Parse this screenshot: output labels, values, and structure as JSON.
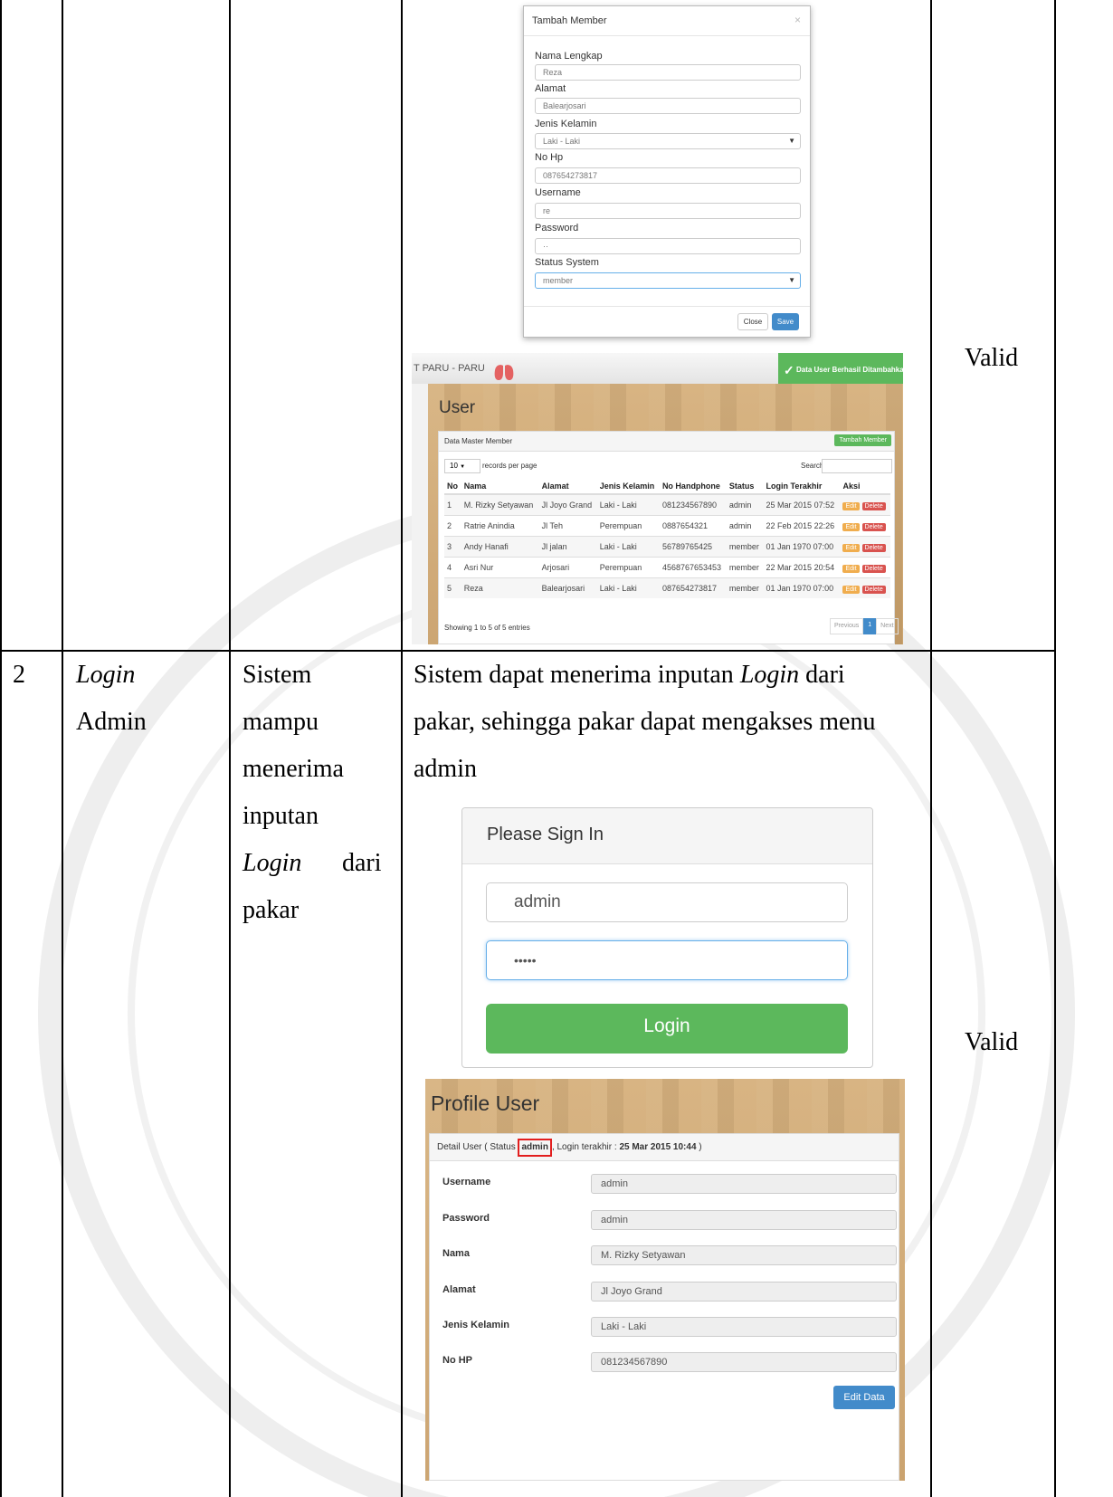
{
  "table": {
    "row1_result": "Valid",
    "row2": {
      "no": "2",
      "name_italic": "Login",
      "name_rest": "Admin",
      "skenario_lines": [
        "Sistem",
        "mampu",
        "menerima",
        "inputan"
      ],
      "skenario_italic": "Login",
      "skenario_dari": "dari",
      "skenario_last": "pakar",
      "hasil_part1": "Sistem dapat menerima inputan",
      "hasil_italic": "Login",
      "hasil_part2": "dari",
      "hasil_line2": "pakar, sehingga pakar dapat mengakses menu",
      "hasil_line3": "admin",
      "result": "Valid"
    }
  },
  "modal": {
    "title": "Tambah Member",
    "close_x": "×",
    "fields": [
      {
        "label": "Nama Lengkap",
        "value": "Reza"
      },
      {
        "label": "Alamat",
        "value": "Balearjosari"
      },
      {
        "label": "Jenis Kelamin",
        "value": "Laki - Laki"
      },
      {
        "label": "No Hp",
        "value": "087654273817"
      },
      {
        "label": "Username",
        "value": "re"
      },
      {
        "label": "Password",
        "value": "··"
      },
      {
        "label": "Status System",
        "value": "member"
      }
    ],
    "close_button": "Close",
    "save_button": "Save"
  },
  "user_page": {
    "brand": "T PARU - PARU",
    "toast": "Data User Berhasil Ditambahkan",
    "heading": "User",
    "panel_title": "Data Master Member",
    "add_button": "Tambah Member",
    "page_size": "10",
    "records_label": "records per page",
    "search_label": "Search:",
    "columns": [
      "No",
      "Nama",
      "Alamat",
      "Jenis Kelamin",
      "No Handphone",
      "Status",
      "Login Terakhir",
      "Aksi"
    ],
    "rows": [
      [
        "1",
        "M. Rizky Setyawan",
        "Jl Joyo Grand",
        "Laki - Laki",
        "081234567890",
        "admin",
        "25 Mar 2015 07:52"
      ],
      [
        "2",
        "Ratrie Anindia",
        "Jl Teh",
        "Perempuan",
        "0887654321",
        "admin",
        "22 Feb 2015 22:26"
      ],
      [
        "3",
        "Andy Hanafi",
        "Jl jalan",
        "Laki - Laki",
        "56789765425",
        "member",
        "01 Jan 1970 07:00"
      ],
      [
        "4",
        "Asri Nur",
        "Arjosari",
        "Perempuan",
        "4568767653453",
        "member",
        "22 Mar 2015 20:54"
      ],
      [
        "5",
        "Reza",
        "Balearjosari",
        "Laki - Laki",
        "087654273817",
        "member",
        "01 Jan 1970 07:00"
      ]
    ],
    "edit_label": "Edit",
    "delete_label": "Delete",
    "showing": "Showing 1 to 5 of 5 entries",
    "prev": "Previous",
    "page": "1",
    "next": "Next"
  },
  "login": {
    "title": "Please Sign In",
    "username": "admin",
    "password": "•••••",
    "button": "Login"
  },
  "profile": {
    "heading": "Profile User",
    "detail_prefix": "Detail User ( Status",
    "status": "admin",
    "detail_mid": ", Login terakhir :",
    "last_login": "25 Mar 2015 10:44",
    "detail_suffix": ")",
    "fields": [
      {
        "label": "Username",
        "value": "admin"
      },
      {
        "label": "Password",
        "value": "admin"
      },
      {
        "label": "Nama",
        "value": "M. Rizky Setyawan"
      },
      {
        "label": "Alamat",
        "value": "Jl Joyo Grand"
      },
      {
        "label": "Jenis Kelamin",
        "value": "Laki - Laki"
      },
      {
        "label": "No HP",
        "value": "081234567890"
      }
    ],
    "edit_button": "Edit Data"
  }
}
